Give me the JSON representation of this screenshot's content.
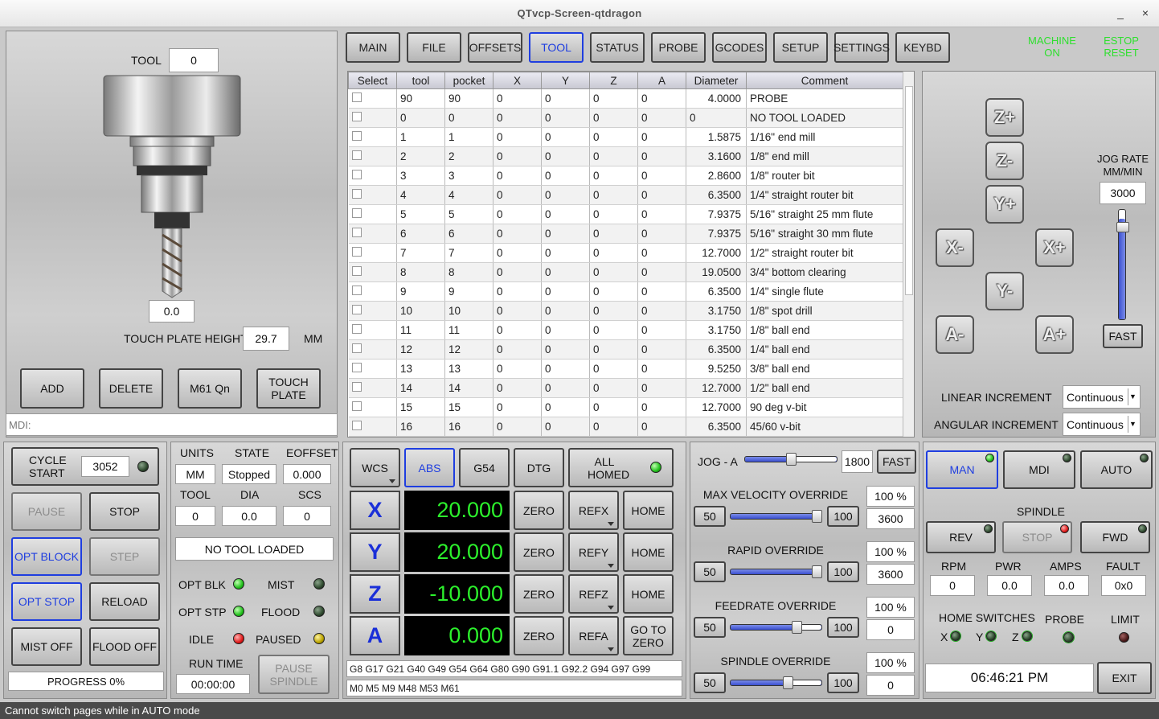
{
  "window": {
    "title": "QTvcp-Screen-qtdragon",
    "minimize": "_",
    "close": "×"
  },
  "tool_panel": {
    "tool_label": "TOOL",
    "tool_value": "0",
    "offset_value": "0.0",
    "touch_plate_label": "TOUCH PLATE HEIGHT",
    "touch_plate_value": "29.7",
    "touch_plate_unit": "MM",
    "buttons": {
      "add": "ADD",
      "delete": "DELETE",
      "m61": "M61 Qn",
      "touch_plate": "TOUCH PLATE"
    },
    "mdi_placeholder": "MDI:"
  },
  "tabs": [
    "MAIN",
    "FILE",
    "OFFSETS",
    "TOOL",
    "STATUS",
    "PROBE",
    "GCODES",
    "SETUP",
    "SETTINGS",
    "KEYBD"
  ],
  "active_tab": "TOOL",
  "machine_status": {
    "machine_on": "MACHINE ON",
    "estop_reset": "ESTOP RESET",
    "color": "#2ee02e"
  },
  "tool_table": {
    "headers": [
      "Select",
      "tool",
      "pocket",
      "X",
      "Y",
      "Z",
      "A",
      "Diameter",
      "Comment"
    ],
    "rows": [
      [
        "",
        "90",
        "90",
        "0",
        "0",
        "0",
        "0",
        "4.0000",
        "PROBE"
      ],
      [
        "",
        "0",
        "0",
        "0",
        "0",
        "0",
        "0",
        "0",
        "NO TOOL LOADED"
      ],
      [
        "",
        "1",
        "1",
        "0",
        "0",
        "0",
        "0",
        "1.5875",
        "1/16\" end mill"
      ],
      [
        "",
        "2",
        "2",
        "0",
        "0",
        "0",
        "0",
        "3.1600",
        "1/8\" end mill"
      ],
      [
        "",
        "3",
        "3",
        "0",
        "0",
        "0",
        "0",
        "2.8600",
        "1/8\" router bit"
      ],
      [
        "",
        "4",
        "4",
        "0",
        "0",
        "0",
        "0",
        "6.3500",
        "1/4\" straight router bit"
      ],
      [
        "",
        "5",
        "5",
        "0",
        "0",
        "0",
        "0",
        "7.9375",
        "5/16\" straight 25 mm flute"
      ],
      [
        "",
        "6",
        "6",
        "0",
        "0",
        "0",
        "0",
        "7.9375",
        "5/16\" straight 30 mm flute"
      ],
      [
        "",
        "7",
        "7",
        "0",
        "0",
        "0",
        "0",
        "12.7000",
        "1/2\" straight router bit"
      ],
      [
        "",
        "8",
        "8",
        "0",
        "0",
        "0",
        "0",
        "19.0500",
        "3/4\" bottom clearing"
      ],
      [
        "",
        "9",
        "9",
        "0",
        "0",
        "0",
        "0",
        "6.3500",
        "1/4\" single flute"
      ],
      [
        "",
        "10",
        "10",
        "0",
        "0",
        "0",
        "0",
        "3.1750",
        "1/8\" spot drill"
      ],
      [
        "",
        "11",
        "11",
        "0",
        "0",
        "0",
        "0",
        "3.1750",
        "1/8\" ball end"
      ],
      [
        "",
        "12",
        "12",
        "0",
        "0",
        "0",
        "0",
        "6.3500",
        "1/4\" ball end"
      ],
      [
        "",
        "13",
        "13",
        "0",
        "0",
        "0",
        "0",
        "9.5250",
        "3/8\" ball end"
      ],
      [
        "",
        "14",
        "14",
        "0",
        "0",
        "0",
        "0",
        "12.7000",
        "1/2\" ball end"
      ],
      [
        "",
        "15",
        "15",
        "0",
        "0",
        "0",
        "0",
        "12.7000",
        "90 deg v-bit"
      ],
      [
        "",
        "16",
        "16",
        "0",
        "0",
        "0",
        "0",
        "6.3500",
        "45/60 v-bit"
      ]
    ]
  },
  "jog_panel": {
    "buttons": {
      "zp": "Z+",
      "zm": "Z-",
      "yp": "Y+",
      "ym": "Y-",
      "xm": "X-",
      "xp": "X+",
      "am": "A-",
      "ap": "A+"
    },
    "jog_rate_label": "JOG RATE MM/MIN",
    "jog_rate_value": "3000",
    "jog_rate_level": 0.92,
    "fast": "FAST",
    "linear_increment_label": "LINEAR INCREMENT",
    "linear_increment_value": "Continuous",
    "angular_increment_label": "ANGULAR INCREMENT",
    "angular_increment_value": "Continuous"
  },
  "cycle_panel": {
    "cycle_start": "CYCLE START",
    "cycle_count": "3052",
    "pause": "PAUSE",
    "stop": "STOP",
    "opt_block": "OPT BLOCK",
    "step": "STEP",
    "opt_stop": "OPT STOP",
    "reload": "RELOAD",
    "mist_off": "MIST OFF",
    "flood_off": "FLOOD OFF",
    "progress": "PROGRESS 0%"
  },
  "info_panel": {
    "units_label": "UNITS",
    "units_value": "MM",
    "state_label": "STATE",
    "state_value": "Stopped",
    "eoffset_label": "EOFFSET",
    "eoffset_value": "0.000",
    "tool_label": "TOOL",
    "tool_value": "0",
    "dia_label": "DIA",
    "dia_value": "0.0",
    "scs_label": "SCS",
    "scs_value": "0",
    "tool_status": "NO TOOL LOADED",
    "opt_blk": "OPT BLK",
    "mist": "MIST",
    "opt_stp": "OPT STP",
    "flood": "FLOOD",
    "idle": "IDLE",
    "paused": "PAUSED",
    "run_time_label": "RUN TIME",
    "run_time_value": "00:00:00",
    "pause_spindle": "PAUSE SPINDLE"
  },
  "dro_panel": {
    "wcs": "WCS",
    "abs": "ABS",
    "g54": "G54",
    "dtg": "DTG",
    "all_homed": "ALL HOMED",
    "axes": [
      {
        "name": "X",
        "value": "20.000",
        "zero": "ZERO",
        "ref": "REFX",
        "home": "HOME"
      },
      {
        "name": "Y",
        "value": "20.000",
        "zero": "ZERO",
        "ref": "REFY",
        "home": "HOME"
      },
      {
        "name": "Z",
        "value": "-10.000",
        "zero": "ZERO",
        "ref": "REFZ",
        "home": "HOME"
      },
      {
        "name": "A",
        "value": "0.000",
        "zero": "ZERO",
        "ref": "REFA",
        "home": "GO TO ZERO"
      }
    ],
    "gcodes": "G8 G17 G21 G40 G49 G54 G64 G80 G90 G91.1 G92.2 G94 G97 G99",
    "mcodes": "M0 M5 M9 M48 M53 M61"
  },
  "override_panel": {
    "jog_a_label": "JOG - A",
    "jog_a_value": "1800",
    "jog_a_level": 0.5,
    "fast": "FAST",
    "overrides": [
      {
        "label": "MAX VELOCITY OVERRIDE",
        "percent": "100 %",
        "min": "50",
        "max": "100",
        "value": "3600",
        "level": 1.0
      },
      {
        "label": "RAPID OVERRIDE",
        "percent": "100 %",
        "min": "50",
        "max": "100",
        "value": "3600",
        "level": 1.0
      },
      {
        "label": "FEEDRATE OVERRIDE",
        "percent": "100 %",
        "min": "50",
        "max": "100",
        "value": "0",
        "level": 0.75
      },
      {
        "label": "SPINDLE OVERRIDE",
        "percent": "100 %",
        "min": "50",
        "max": "100",
        "value": "0",
        "level": 0.65
      }
    ]
  },
  "spindle_panel": {
    "man": "MAN",
    "mdi": "MDI",
    "auto": "AUTO",
    "spindle_label": "SPINDLE",
    "rev": "REV",
    "stop": "STOP",
    "fwd": "FWD",
    "rpm_label": "RPM",
    "rpm_value": "0",
    "pwr_label": "PWR",
    "pwr_value": "0.0",
    "amps_label": "AMPS",
    "amps_value": "0.0",
    "fault_label": "FAULT",
    "fault_value": "0x0",
    "home_switches": "HOME SWITCHES",
    "probe": "PROBE",
    "limit": "LIMIT",
    "hx": "X",
    "hy": "Y",
    "hz": "Z",
    "clock": "06:46:21 PM",
    "exit": "EXIT"
  },
  "status_bar": "Cannot switch pages while in AUTO mode"
}
